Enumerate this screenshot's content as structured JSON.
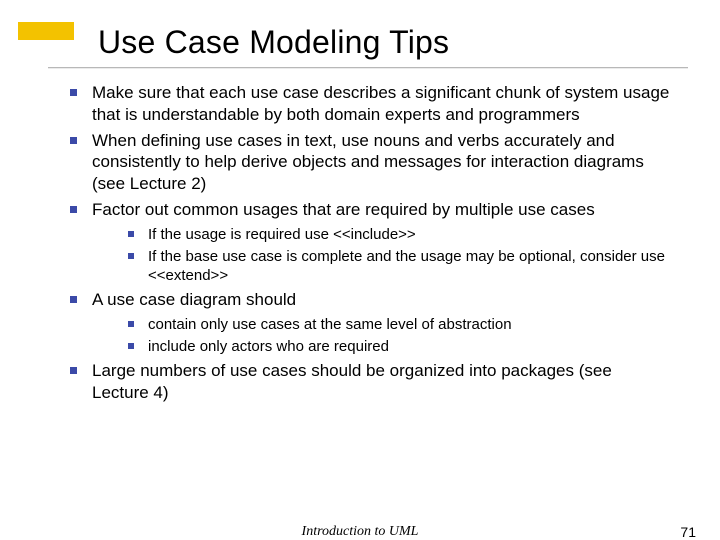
{
  "title": "Use Case Modeling Tips",
  "bullets": {
    "b1": "Make sure that each use case describes a significant chunk of system usage that is understandable by both domain experts and programmers",
    "b2": "When defining use cases in text, use nouns and verbs accurately and consistently to help derive objects and messages for interaction diagrams (see Lecture 2)",
    "b3": "Factor out common usages that are required by multiple use cases",
    "b3_sub": {
      "s1": "If the usage is required use <<include>>",
      "s2": "If the base use case is complete and the usage may be optional, consider use <<extend>>"
    },
    "b4": "A use case diagram should",
    "b4_sub": {
      "s1": "contain only use cases at the same level of abstraction",
      "s2": "include only actors who are required"
    },
    "b5": "Large numbers of use cases should be organized into packages (see Lecture 4)"
  },
  "footer": {
    "center": "Introduction to UML",
    "page": "71"
  }
}
